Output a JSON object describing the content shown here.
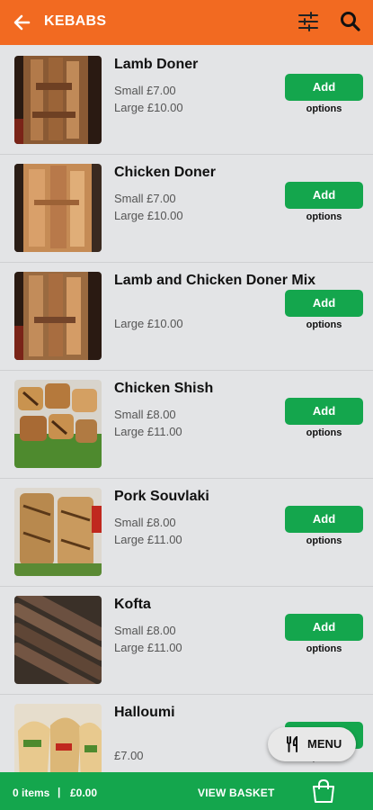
{
  "header": {
    "title": "KEBABS",
    "accent": "#f26a21"
  },
  "items": [
    {
      "name": "Lamb Doner",
      "small": "Small £7.00",
      "large": "Large £10.00",
      "add": "Add",
      "options": "options",
      "thumb": "doner-lamb"
    },
    {
      "name": "Chicken Doner",
      "small": "Small £7.00",
      "large": "Large £10.00",
      "add": "Add",
      "options": "options",
      "thumb": "doner-chicken"
    },
    {
      "name": "Lamb and Chicken Doner Mix",
      "small": "",
      "large": "Large £10.00",
      "add": "Add",
      "options": "options",
      "thumb": "doner-mix"
    },
    {
      "name": "Chicken Shish",
      "small": "Small £8.00",
      "large": "Large £11.00",
      "add": "Add",
      "options": "options",
      "thumb": "shish"
    },
    {
      "name": "Pork Souvlaki",
      "small": "Small £8.00",
      "large": "Large £11.00",
      "add": "Add",
      "options": "options",
      "thumb": "souvlaki"
    },
    {
      "name": "Kofta",
      "small": "Small £8.00",
      "large": "Large £11.00",
      "add": "Add",
      "options": "options",
      "thumb": "kofta"
    },
    {
      "name": "Halloumi",
      "small": "",
      "large": "£7.00",
      "add": "Add",
      "options": "options",
      "thumb": "halloumi"
    }
  ],
  "fab": {
    "label": "MENU"
  },
  "basket": {
    "items": "0 items",
    "separator": "|",
    "total": "£0.00",
    "view_label": "VIEW BASKET",
    "color": "#14a64d"
  }
}
